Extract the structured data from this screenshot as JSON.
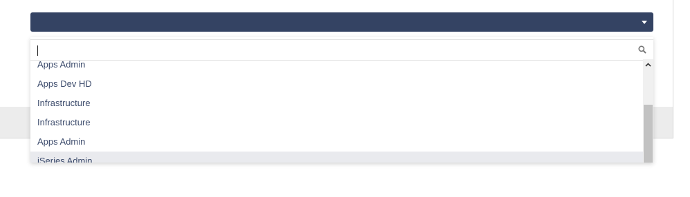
{
  "search": {
    "value": "",
    "placeholder": ""
  },
  "dropdown": {
    "items": [
      "Apps Admin",
      "Apps Dev HD",
      "Infrastructure",
      "Infrastructure",
      "Apps Admin",
      "iSeries Admin"
    ],
    "highlighted_index": 5
  },
  "colors": {
    "select_bar": "#344363",
    "item_text": "#3b4a6b",
    "highlight": "#e9eaee"
  },
  "icons": {
    "caret": "chevron-down-icon",
    "search": "search-icon",
    "scroll_up": "chevron-up-icon"
  }
}
